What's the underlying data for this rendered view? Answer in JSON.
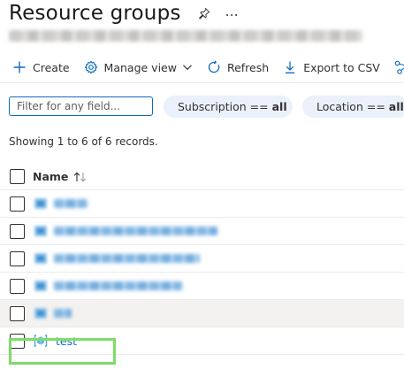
{
  "page": {
    "title": "Resource groups",
    "subtitle": "Microsoft Azure"
  },
  "header_icons": {
    "pin": "pin-icon",
    "more": "…"
  },
  "toolbar": {
    "create_label": "Create",
    "manage_view_label": "Manage view",
    "refresh_label": "Refresh",
    "export_label": "Export to CSV"
  },
  "filters": {
    "search_placeholder": "Filter for any field...",
    "subscription_label": "Subscription ==",
    "subscription_value": "all",
    "location_label": "Location ==",
    "location_value": "all"
  },
  "records_text": "Showing 1 to 6 of 6 records.",
  "table": {
    "name_header": "Name",
    "sort_glyph": "↑↓",
    "rows": [
      {
        "name": "",
        "blurred": true
      },
      {
        "name": "",
        "blurred": true
      },
      {
        "name": "",
        "blurred": true
      },
      {
        "name": "",
        "blurred": true
      },
      {
        "name": "",
        "blurred": true
      },
      {
        "name": "test",
        "blurred": false
      }
    ]
  },
  "colors": {
    "accent": "#0f6cbd",
    "pill_bg": "#eaf1fb",
    "highlight": "#7ddc6a",
    "row_hover": "#f3f2f1"
  }
}
